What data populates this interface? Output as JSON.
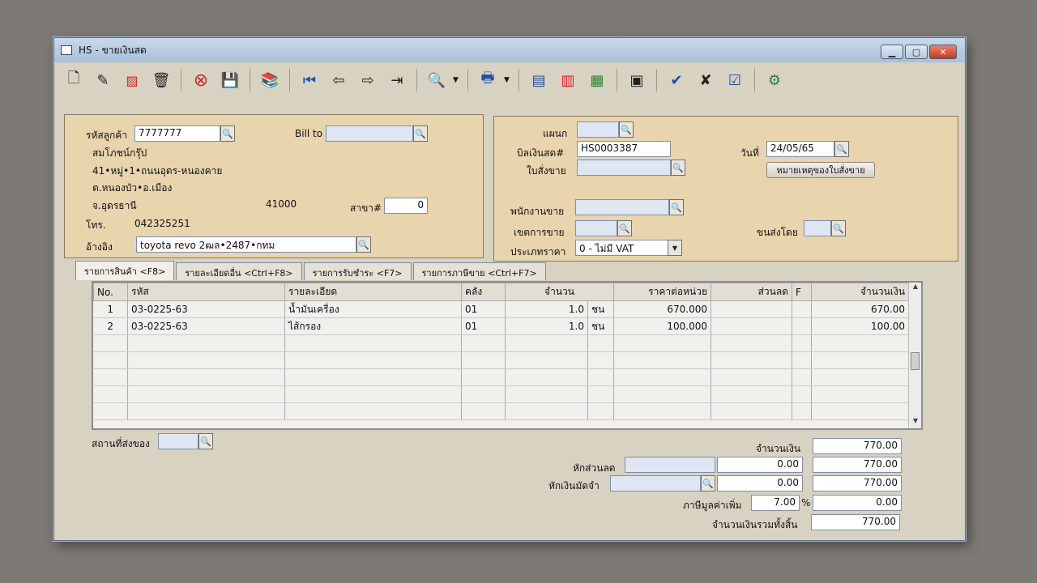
{
  "window": {
    "title": "HS - ขายเงินสด",
    "minimize": "▁",
    "maximize": "▢",
    "close": "✕"
  },
  "toolbar": {
    "icons": [
      "new-doc-icon",
      "edit-icon",
      "eraser-icon",
      "trash-icon",
      "cancel-icon",
      "save-icon",
      "books-icon",
      "first-record-icon",
      "prev-record-icon",
      "next-record-icon",
      "last-record-icon",
      "zoom-icon",
      "print-icon",
      "report1-icon",
      "report2-icon",
      "report3-icon",
      "document-icon",
      "approve-ok-icon",
      "unapprove-icon",
      "ok-icon",
      "settings-icon"
    ]
  },
  "customer": {
    "code_label": "รหัสลูกค้า",
    "code": "7777777",
    "bill_to_label": "Bill to",
    "name": "สมโภชน์กรุ๊ป",
    "address1": "41•หมู่•1•ถนนอุดร-หนองคาย",
    "address2": "ต.หนองบัว•อ.เมือง",
    "province": "จ.อุดรธานี",
    "postcode": "41000",
    "branch_label": "สาขา#",
    "branch": "0",
    "phone_label": "โทร.",
    "phone": "042325251",
    "ref_label": "อ้างอิง",
    "ref": "toyota revo 2ฒล•2487•กทม"
  },
  "doc": {
    "dept_label": "แผนก",
    "bill_label": "บิลเงินสด#",
    "bill_no": "HS0003387",
    "date_label": "วันที่",
    "date": "24/05/65",
    "order_label": "ใบสั่งขาย",
    "order_note_button": "หมายเหตุของใบสั่งขาย",
    "salesman_label": "พนักงานขาย",
    "area_label": "เขตการขาย",
    "ship_by_label": "ขนส่งโดย",
    "price_type_label": "ประเภทราคา",
    "price_type": "0 - ไม่มี VAT"
  },
  "tabs": [
    "รายการสินค้า <F8>",
    "รายละเอียดอื่น <Ctrl+F8>",
    "รายการรับชำระ <F7>",
    "รายการภาษีขาย <Ctrl+F7>"
  ],
  "table": {
    "headers": [
      "No.",
      "รหัส",
      "รายละเอียด",
      "คลัง",
      "จำนวน",
      "ราคาต่อหน่วย",
      "ส่วนลด",
      "F",
      "จำนวนเงิน"
    ],
    "rows": [
      [
        "1",
        "03-0225-63",
        "น้ำมันเครื่อง",
        "01",
        "1.0",
        "ชน",
        "670.000",
        "",
        "",
        "670.00"
      ],
      [
        "2",
        "03-0225-63",
        "ไส้กรอง",
        "01",
        "1.0",
        "ชน",
        "100.000",
        "",
        "",
        "100.00"
      ]
    ]
  },
  "footer": {
    "ship_place_label": "สถานที่ส่งของ",
    "amount_label": "จำนวนเงิน",
    "amount": "770.00",
    "discount_label": "หักส่วนลด",
    "discount": "0.00",
    "after_discount": "770.00",
    "deposit_label": "หักเงินมัดจำ",
    "deposit": "0.00",
    "after_deposit": "770.00",
    "vat_label": "ภาษีมูลค่าเพิ่ม",
    "vat_rate": "7.00",
    "percent": "%",
    "vat_amount": "0.00",
    "total_label": "จำนวนเงินรวมทั้งสิ้น",
    "total": "770.00"
  }
}
